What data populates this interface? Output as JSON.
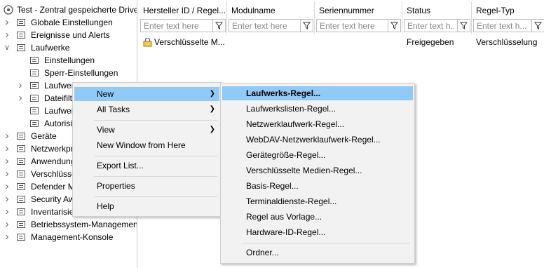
{
  "tree": {
    "root": "Test - Zentral gespeicherte Drive",
    "items": [
      {
        "label": "Globale Einstellungen",
        "icon": "settings-globe-icon",
        "level": 1,
        "chevron": "right"
      },
      {
        "label": "Ereignisse und Alerts",
        "icon": "alert-icon",
        "level": 1,
        "chevron": "right"
      },
      {
        "label": "Laufwerke",
        "icon": "drive-icon",
        "level": 1,
        "chevron": "down"
      },
      {
        "label": "Einstellungen",
        "icon": "gear-icon",
        "level": 2,
        "chevron": ""
      },
      {
        "label": "Sperr-Einstellungen",
        "icon": "lock-icon",
        "level": 2,
        "chevron": ""
      },
      {
        "label": "Laufwerks-Whitelist-R",
        "icon": "list-check-icon",
        "level": 2,
        "chevron": "right"
      },
      {
        "label": "Dateifilter",
        "icon": "file-filter-icon",
        "level": 2,
        "chevron": "right"
      },
      {
        "label": "Laufwerksliste",
        "icon": "folder-icon",
        "level": 2,
        "chevron": ""
      },
      {
        "label": "Autorisierung",
        "icon": "key-icon",
        "level": 2,
        "chevron": ""
      },
      {
        "label": "Geräte",
        "icon": "device-icon",
        "level": 1,
        "chevron": "right"
      },
      {
        "label": "Netzwerkprofile",
        "icon": "network-icon",
        "level": 1,
        "chevron": "right"
      },
      {
        "label": "Anwendungen",
        "icon": "app-icon",
        "level": 1,
        "chevron": "right"
      },
      {
        "label": "Verschlüsselung",
        "icon": "encryption-icon",
        "level": 1,
        "chevron": "right"
      },
      {
        "label": "Defender Management",
        "icon": "shield-icon",
        "level": 1,
        "chevron": "right"
      },
      {
        "label": "Security Awareness",
        "icon": "security-icon",
        "level": 1,
        "chevron": "right"
      },
      {
        "label": "Inventarisierung",
        "icon": "inventory-icon",
        "level": 1,
        "chevron": "right"
      },
      {
        "label": "Betriebssystem-Management",
        "icon": "os-icon",
        "level": 1,
        "chevron": "right"
      },
      {
        "label": "Management-Konsole",
        "icon": "console-icon",
        "level": 1,
        "chevron": "right"
      }
    ]
  },
  "columns": [
    {
      "title": "Hersteller ID / Regel...",
      "placeholder": "Enter text here"
    },
    {
      "title": "Modulname",
      "placeholder": "Enter text here"
    },
    {
      "title": "Seriennummer",
      "placeholder": "Enter text here"
    },
    {
      "title": "Status",
      "placeholder": "Enter text h..."
    },
    {
      "title": "Regel-Typ",
      "placeholder": "Enter text h..."
    }
  ],
  "rows": [
    {
      "name": "Verschlüsselte M...",
      "module": "",
      "serial": "",
      "status": "Freigegeben",
      "type": "Verschlüsselung"
    }
  ],
  "context_menu": {
    "items": [
      {
        "label": "New",
        "submenu": true
      },
      {
        "label": "All Tasks",
        "submenu": true
      },
      {
        "label": "View",
        "submenu": true
      },
      {
        "label": "New Window from Here",
        "submenu": false
      },
      {
        "label": "Export List...",
        "submenu": false
      },
      {
        "label": "Properties",
        "submenu": false
      },
      {
        "label": "Help",
        "submenu": false
      }
    ]
  },
  "submenu": {
    "items": [
      "Laufwerks-Regel...",
      "Laufwerkslisten-Regel...",
      "Netzwerklaufwerk-Regel...",
      "WebDAV-Netzwerklaufwerk-Regel...",
      "Gerätegröße-Regel...",
      "Verschlüsselte Medien-Regel...",
      "Basis-Regel...",
      "Terminaldienste-Regel...",
      "Regel aus Vorlage...",
      "Hardware-ID-Regel...",
      "Ordner..."
    ]
  },
  "colors": {
    "highlight": "#91c9f7",
    "menu_bg": "#f2f2f2"
  }
}
